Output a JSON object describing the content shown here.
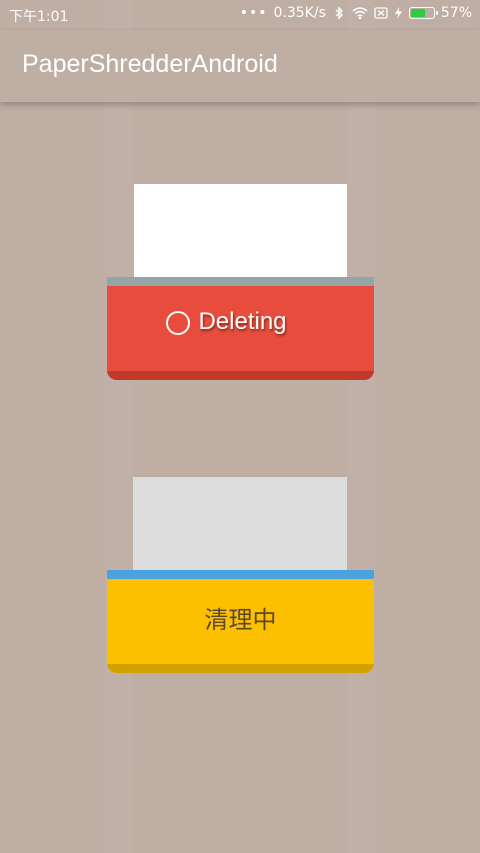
{
  "status_bar": {
    "time": "下午1:01",
    "network_speed": "0.35K/s",
    "battery_percent": "57%",
    "battery_level": 0.57,
    "icons": [
      "dots-icon",
      "bluetooth-icon",
      "wifi-icon",
      "sim-x-icon",
      "charging-icon",
      "battery-icon"
    ]
  },
  "app_bar": {
    "title": "PaperShredderAndroid"
  },
  "shredder_1": {
    "label": "Deleting",
    "paper_color": "#ffffff",
    "body_color": "#e74c3c",
    "slot_color": "#95a5a6",
    "lip_color": "#c0392b",
    "text_color": "#ffffff",
    "icon": "loading-circle-icon"
  },
  "shredder_2": {
    "label": "清理中",
    "paper_color": "#dcdcdc",
    "body_color": "#fcc000",
    "slot_color": "#4aa3df",
    "lip_color": "#d4a200",
    "text_color": "#5a4a2a"
  }
}
